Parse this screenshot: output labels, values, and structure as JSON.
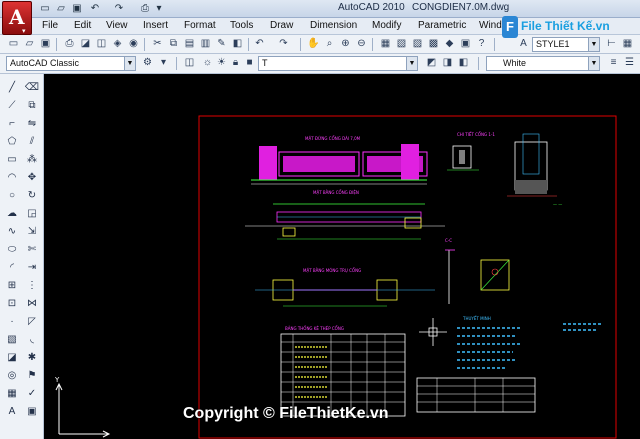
{
  "app": {
    "logo_letter": "A",
    "logo_sub": "▾"
  },
  "titlebar": {
    "app_name": "AutoCAD 2010",
    "file_name": "CONGDIEN7.0M.dwg"
  },
  "quick_access": [
    {
      "icon": "new-icon",
      "glyph": "▭"
    },
    {
      "icon": "open-icon",
      "glyph": "▱"
    },
    {
      "icon": "save-icon",
      "glyph": "▣"
    },
    {
      "icon": "undo-icon",
      "glyph": "↶"
    },
    {
      "icon": "redo-icon",
      "glyph": "↷"
    },
    {
      "icon": "plot-icon",
      "glyph": "⎙"
    },
    {
      "icon": "dropdown-icon",
      "glyph": "▾"
    }
  ],
  "menu": [
    "File",
    "Edit",
    "View",
    "Insert",
    "Format",
    "Tools",
    "Draw",
    "Dimension",
    "Modify",
    "Parametric",
    "Wind"
  ],
  "brand": {
    "icon_letter": "F",
    "text": "File Thiết Kế.vn"
  },
  "toolbar": {
    "text_style": "STYLE1",
    "workspace": "AutoCAD Classic",
    "layer": "T",
    "color": "White"
  },
  "drawing": {
    "title_elevation": "MẶT ĐỨNG CỔNG DÀI 7,0M",
    "title_plan": "MẶT BẰNG CỔNG ĐIỆN",
    "title_section": "MẶT BẰNG MÓNG TRỤ CỔNG",
    "title_detail": "CHI TIẾT CỔNG 1-1",
    "title_notes": "THUYẾT MINH",
    "title_table": "BẢNG THỐNG KÊ THÉP CỔNG",
    "title_cc": "C-C"
  },
  "copyright": "Copyright © FileThietKe.vn"
}
